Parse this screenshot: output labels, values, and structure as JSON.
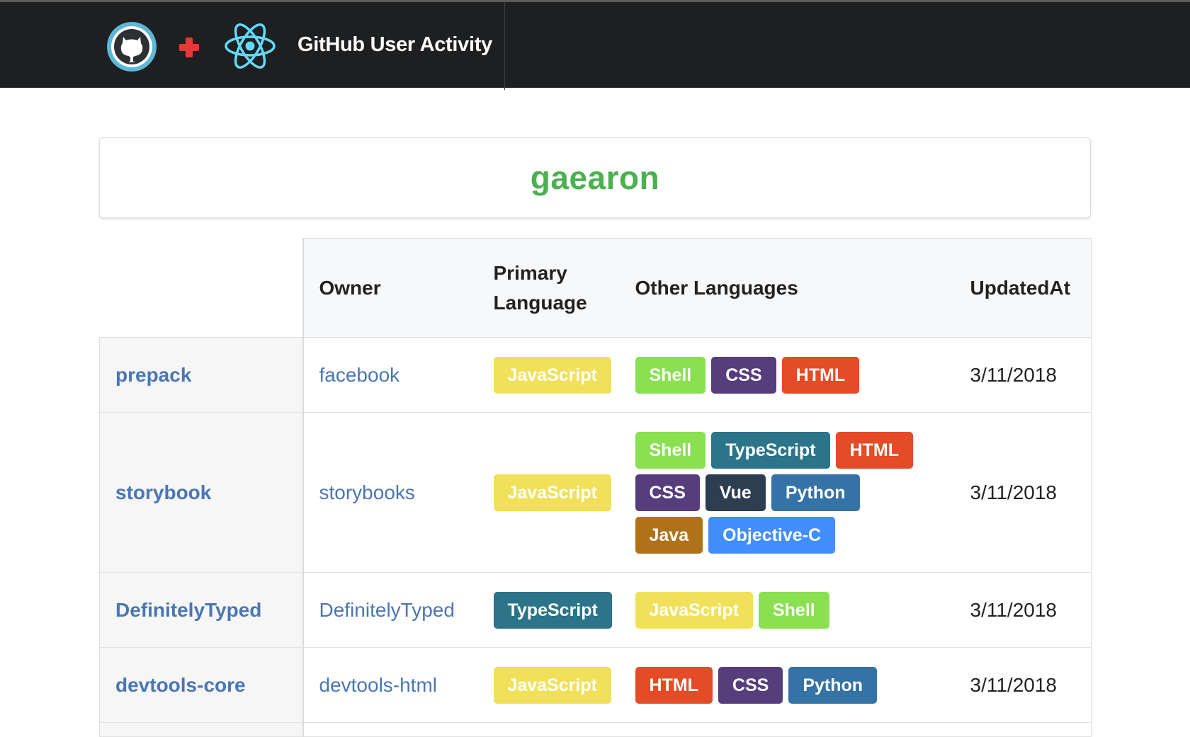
{
  "header": {
    "title": "GitHub User Activity",
    "icons": [
      "github-octocat-icon",
      "plus-icon",
      "react-atom-icon"
    ]
  },
  "user": {
    "login": "gaearon"
  },
  "table": {
    "columns": {
      "owner": "Owner",
      "primary_line1": "Primary",
      "primary_line2": "Language",
      "other": "Other Languages",
      "updated": "UpdatedAt"
    },
    "rows": [
      {
        "name": "prepack",
        "owner": "facebook",
        "primary": "JavaScript",
        "other": [
          "Shell",
          "CSS",
          "HTML"
        ],
        "updated": "3/11/2018"
      },
      {
        "name": "storybook",
        "owner": "storybooks",
        "primary": "JavaScript",
        "other": [
          "Shell",
          "TypeScript",
          "HTML",
          "CSS",
          "Vue",
          "Python",
          "Java",
          "Objective-C"
        ],
        "updated": "3/11/2018"
      },
      {
        "name": "DefinitelyTyped",
        "owner": "DefinitelyTyped",
        "primary": "TypeScript",
        "other": [
          "JavaScript",
          "Shell"
        ],
        "updated": "3/11/2018"
      },
      {
        "name": "devtools-core",
        "owner": "devtools-html",
        "primary": "JavaScript",
        "other": [
          "HTML",
          "CSS",
          "Python"
        ],
        "updated": "3/11/2018"
      }
    ]
  },
  "colors": {
    "header_bg": "#1e1f21",
    "username": "#4cb050",
    "link": "#4a76b4",
    "lang": {
      "JavaScript": "#f1e05a",
      "Shell": "#89e051",
      "CSS": "#563d7c",
      "HTML": "#e34c26",
      "TypeScript": "#2b7489",
      "Vue": "#2c3e50",
      "Python": "#3572a5",
      "Java": "#b07219",
      "Objective-C": "#438eff"
    }
  }
}
